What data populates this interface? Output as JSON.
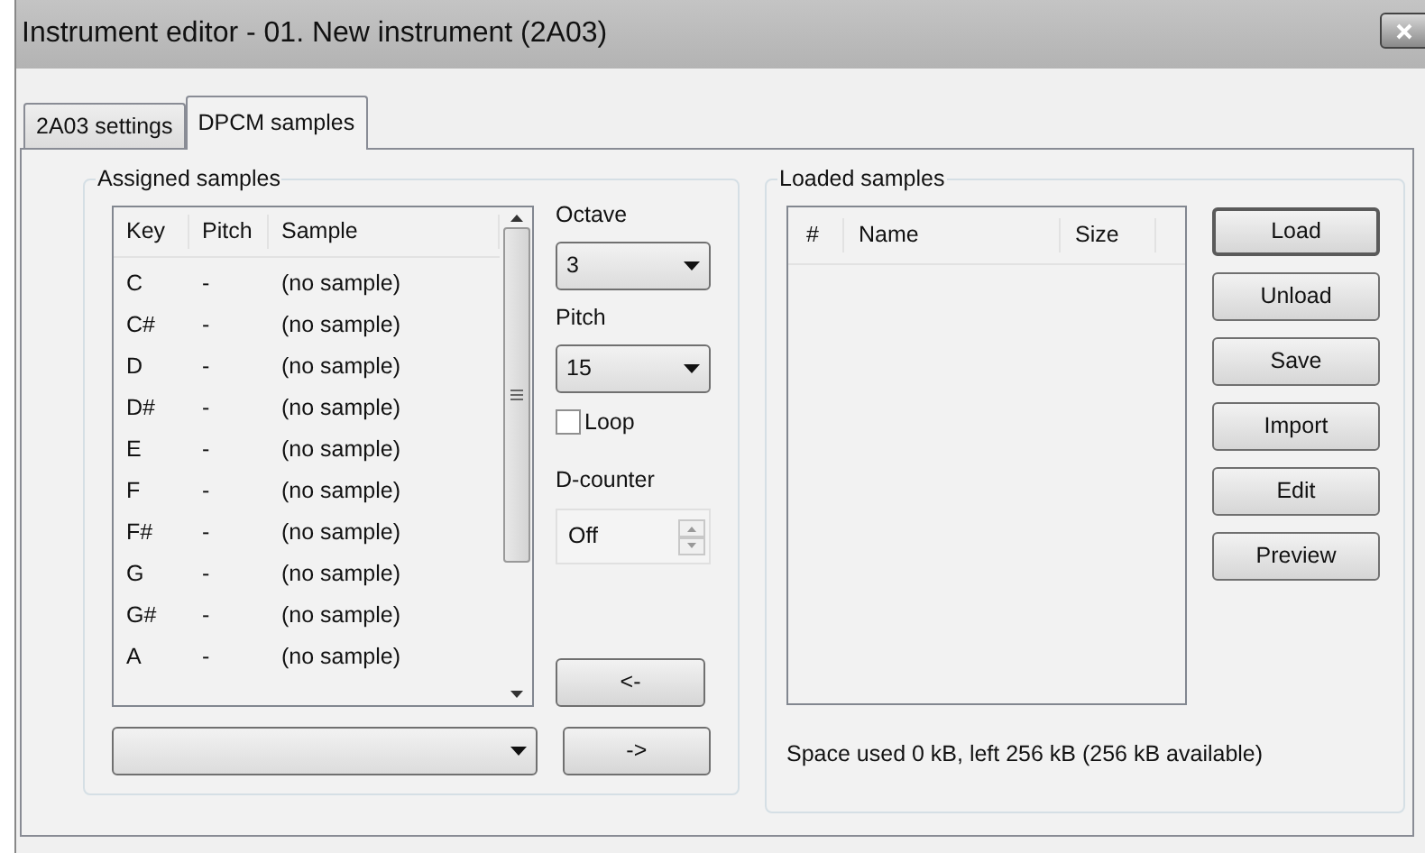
{
  "window": {
    "title": "Instrument editor - 01. New instrument (2A03)"
  },
  "tabs": [
    {
      "label": "2A03 settings",
      "selected": false
    },
    {
      "label": "DPCM samples",
      "selected": true
    }
  ],
  "assigned": {
    "title": "Assigned samples",
    "columns": [
      "Key",
      "Pitch",
      "Sample"
    ],
    "rows": [
      {
        "key": "C",
        "pitch": "-",
        "sample": "(no sample)"
      },
      {
        "key": "C#",
        "pitch": "-",
        "sample": "(no sample)"
      },
      {
        "key": "D",
        "pitch": "-",
        "sample": "(no sample)"
      },
      {
        "key": "D#",
        "pitch": "-",
        "sample": "(no sample)"
      },
      {
        "key": "E",
        "pitch": "-",
        "sample": "(no sample)"
      },
      {
        "key": "F",
        "pitch": "-",
        "sample": "(no sample)"
      },
      {
        "key": "F#",
        "pitch": "-",
        "sample": "(no sample)"
      },
      {
        "key": "G",
        "pitch": "-",
        "sample": "(no sample)"
      },
      {
        "key": "G#",
        "pitch": "-",
        "sample": "(no sample)"
      },
      {
        "key": "A",
        "pitch": "-",
        "sample": "(no sample)"
      }
    ],
    "octave": {
      "label": "Octave",
      "value": "3"
    },
    "pitch": {
      "label": "Pitch",
      "value": "15"
    },
    "loop": {
      "label": "Loop",
      "checked": false
    },
    "dcounter": {
      "label": "D-counter",
      "value": "Off"
    },
    "assign_button": "<-",
    "remove_button": "->"
  },
  "loaded": {
    "title": "Loaded samples",
    "columns": [
      "#",
      "Name",
      "Size"
    ],
    "buttons": [
      {
        "label": "Load",
        "default": true
      },
      {
        "label": "Unload",
        "default": false
      },
      {
        "label": "Save",
        "default": false
      },
      {
        "label": "Import",
        "default": false
      },
      {
        "label": "Edit",
        "default": false
      },
      {
        "label": "Preview",
        "default": false
      }
    ],
    "status": "Space used 0 kB, left 256 kB (256 kB available)"
  }
}
